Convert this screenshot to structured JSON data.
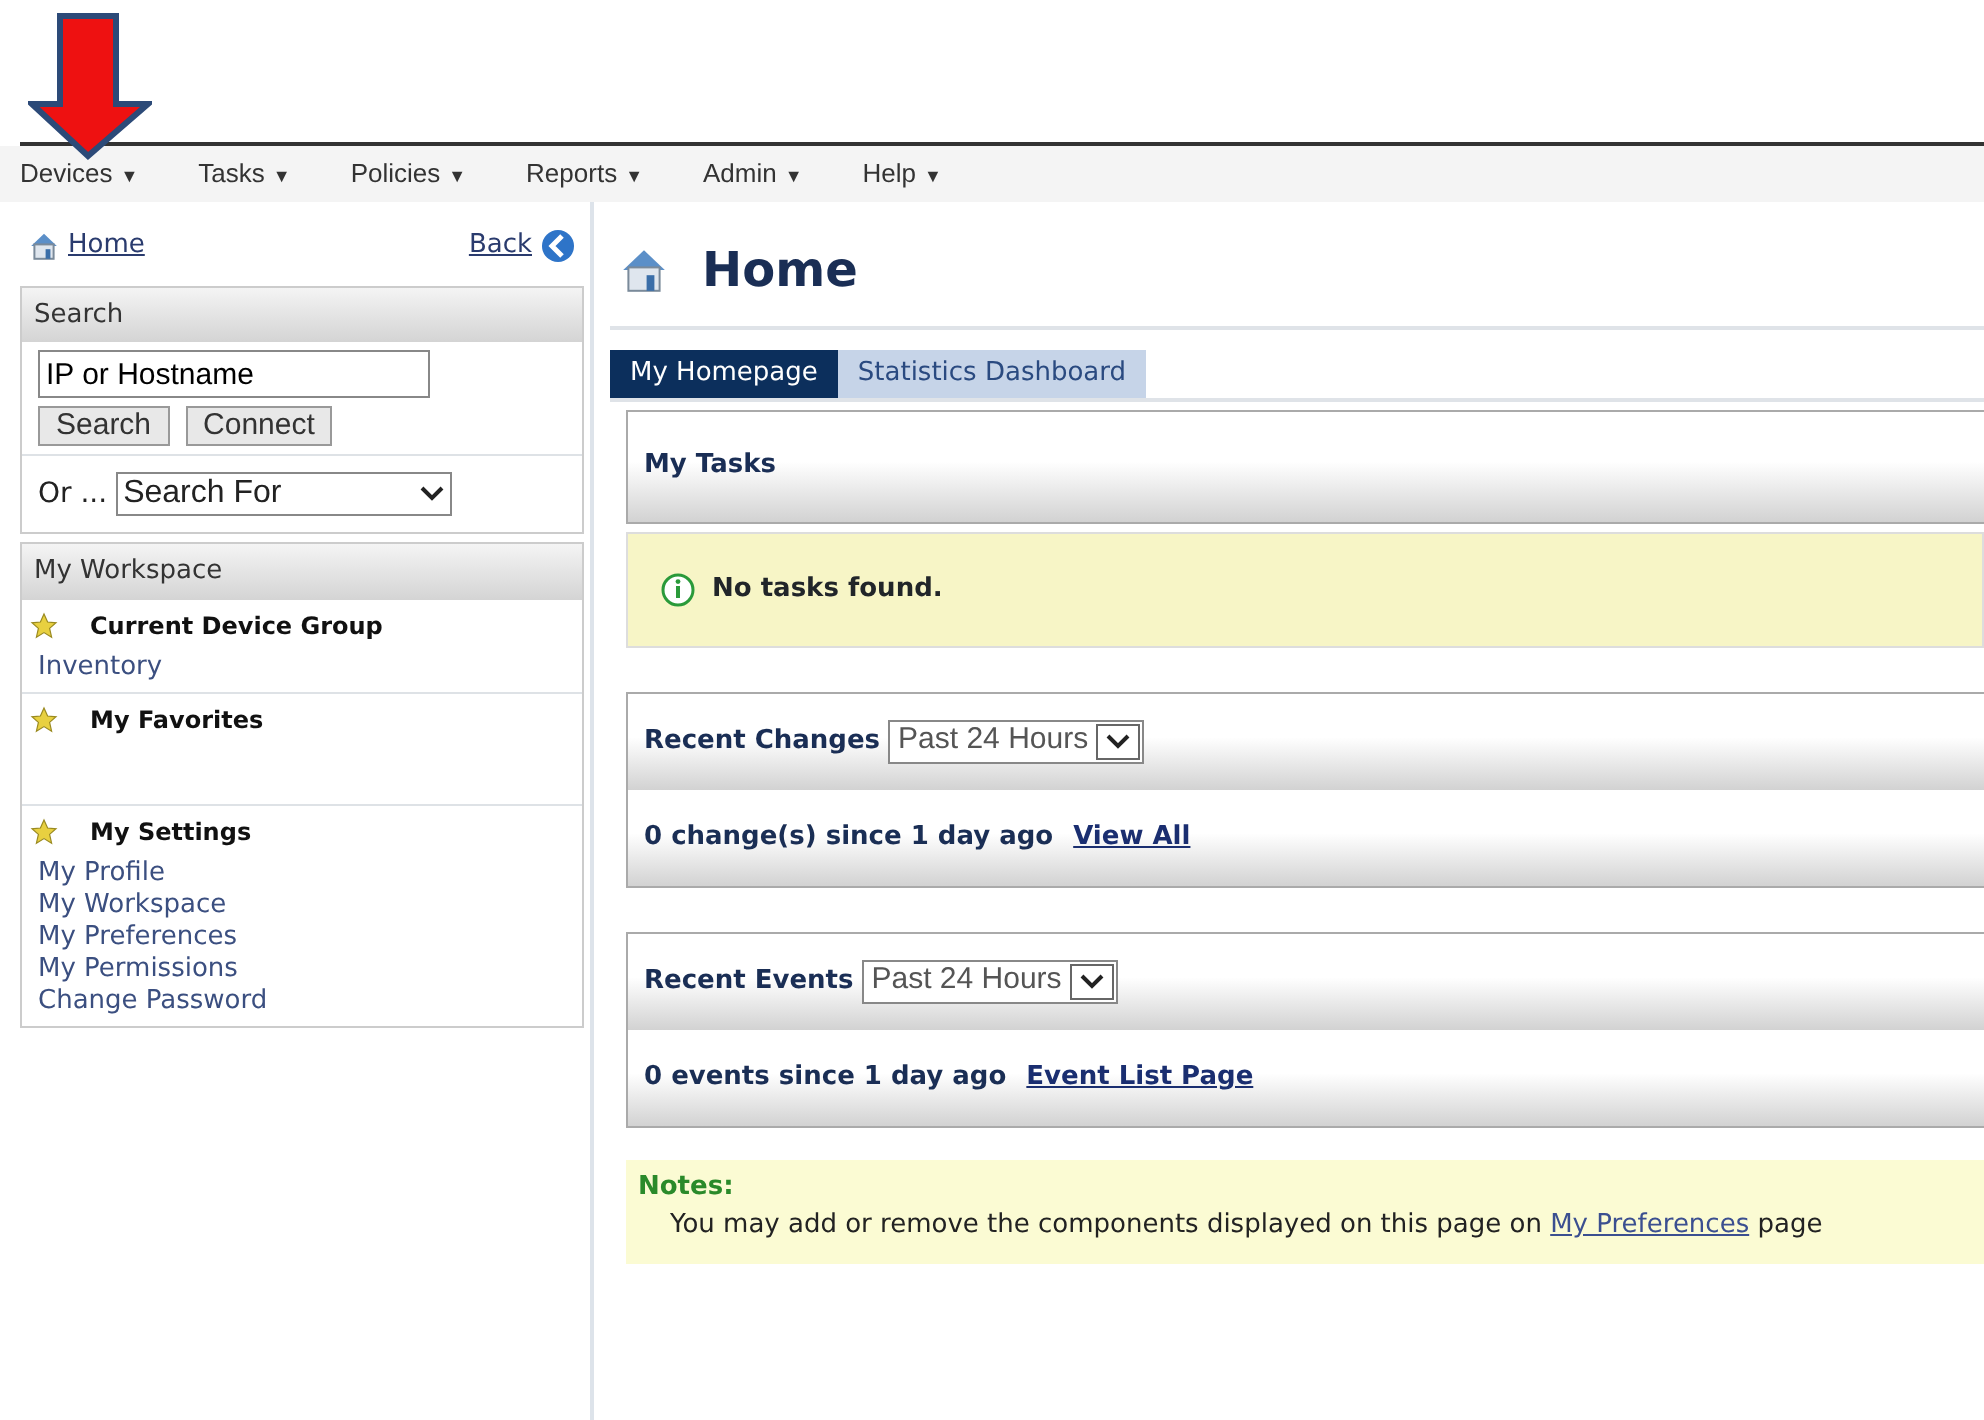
{
  "menu": [
    {
      "label": "Devices",
      "caret": "▼"
    },
    {
      "label": "Tasks",
      "caret": "▼"
    },
    {
      "label": "Policies",
      "caret": "▼"
    },
    {
      "label": "Reports",
      "caret": "▼"
    },
    {
      "label": "Admin",
      "caret": "▼"
    },
    {
      "label": "Help",
      "caret": "▼"
    }
  ],
  "sidebar": {
    "home_link": "Home",
    "back_link": "Back",
    "search": {
      "title": "Search",
      "field_value": "IP or Hostname",
      "buttons": [
        "Search",
        "Connect"
      ],
      "or_label": "Or ...",
      "select_value": "Search For"
    },
    "workspace": {
      "title": "My Workspace",
      "groups": [
        {
          "title": "Current Device Group",
          "links": [
            "Inventory"
          ]
        },
        {
          "title": "My Favorites"
        },
        {
          "title": "My Settings",
          "links": [
            "My Profile",
            "My Workspace",
            "My Preferences",
            "My Permissions",
            "Change Password"
          ]
        }
      ]
    }
  },
  "page": {
    "title": "Home",
    "tabs": [
      {
        "label": "My Homepage",
        "selected": true
      },
      {
        "label": "Statistics Dashboard",
        "selected": false
      }
    ],
    "tasks": {
      "title": "My Tasks",
      "message": "No tasks found."
    },
    "panels": [
      {
        "title": "Recent Changes",
        "select_value": "Past 24 Hours",
        "summary": "0 change(s) since 1 day ago",
        "link": "View All"
      },
      {
        "title": "Recent Events",
        "select_value": "Past 24 Hours",
        "summary": "0 events since 1 day ago",
        "link": "Event List Page"
      }
    ],
    "notes": {
      "title": "Notes:",
      "text_before": "You may add or remove the components displayed on this page on ",
      "link": "My Preferences",
      "text_after": " page"
    }
  }
}
